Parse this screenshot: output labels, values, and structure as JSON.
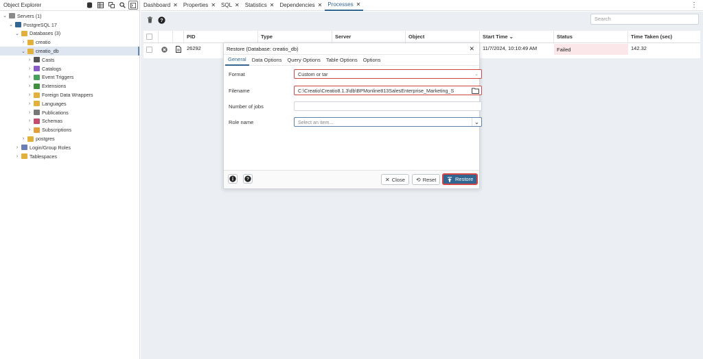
{
  "left_panel": {
    "title": "Object Explorer",
    "tree": [
      {
        "label": "Servers (1)",
        "chevron": "⌄",
        "icon": "server-group-icon",
        "color": "#8a8a8a",
        "depth": 0
      },
      {
        "label": "PostgreSQL 17",
        "chevron": "⌄",
        "icon": "postgres-elephant-icon",
        "color": "#336791",
        "depth": 1
      },
      {
        "label": "Databases (3)",
        "chevron": "⌄",
        "icon": "databases-icon",
        "color": "#e2b13c",
        "depth": 2
      },
      {
        "label": "creatio",
        "chevron": "›",
        "icon": "database-icon",
        "color": "#e2b13c",
        "depth": 3
      },
      {
        "label": "creatio_db",
        "chevron": "⌄",
        "icon": "database-icon",
        "color": "#e2b13c",
        "depth": 3,
        "selected": true
      },
      {
        "label": "Casts",
        "chevron": "›",
        "icon": "casts-icon",
        "color": "#555555",
        "depth": 4
      },
      {
        "label": "Catalogs",
        "chevron": "›",
        "icon": "catalogs-icon",
        "color": "#8a5cc7",
        "depth": 4
      },
      {
        "label": "Event Triggers",
        "chevron": "›",
        "icon": "event-triggers-icon",
        "color": "#4aa05a",
        "depth": 4
      },
      {
        "label": "Extensions",
        "chevron": "›",
        "icon": "extensions-icon",
        "color": "#3f8f3f",
        "depth": 4
      },
      {
        "label": "Foreign Data Wrappers",
        "chevron": "›",
        "icon": "foreign-data-wrappers-icon",
        "color": "#e2b13c",
        "depth": 4
      },
      {
        "label": "Languages",
        "chevron": "›",
        "icon": "languages-icon",
        "color": "#e2b13c",
        "depth": 4
      },
      {
        "label": "Publications",
        "chevron": "›",
        "icon": "publications-icon",
        "color": "#777777",
        "depth": 4
      },
      {
        "label": "Schemas",
        "chevron": "›",
        "icon": "schemas-icon",
        "color": "#c44c6c",
        "depth": 4
      },
      {
        "label": "Subscriptions",
        "chevron": "›",
        "icon": "subscriptions-icon",
        "color": "#e2a03c",
        "depth": 4
      },
      {
        "label": "postgres",
        "chevron": "›",
        "icon": "database-icon",
        "color": "#e2b13c",
        "depth": 3
      },
      {
        "label": "Login/Group Roles",
        "chevron": "›",
        "icon": "login-group-roles-icon",
        "color": "#6a7fb5",
        "depth": 2
      },
      {
        "label": "Tablespaces",
        "chevron": "›",
        "icon": "tablespaces-icon",
        "color": "#e2b13c",
        "depth": 2
      }
    ]
  },
  "tabs": [
    {
      "label": "Dashboard",
      "active": false
    },
    {
      "label": "Properties",
      "active": false
    },
    {
      "label": "SQL",
      "active": false
    },
    {
      "label": "Statistics",
      "active": false
    },
    {
      "label": "Dependencies",
      "active": false
    },
    {
      "label": "Processes",
      "active": true
    }
  ],
  "toolbar": {
    "search_placeholder": "Search"
  },
  "grid": {
    "columns": [
      "PID",
      "Type",
      "Server",
      "Object",
      "Start Time",
      "Status",
      "Time Taken (sec)"
    ],
    "sort_indicator": "⌄",
    "rows": [
      {
        "pid": "26292",
        "type": "",
        "server": "",
        "object": "",
        "start_time": "11/7/2024, 10:10:49 AM",
        "status": "Failed",
        "time_taken": "142.32"
      }
    ]
  },
  "dialog": {
    "title": "Restore (Database: creatio_db)",
    "tabs": [
      "General",
      "Data Options",
      "Query Options",
      "Table Options",
      "Options"
    ],
    "active_tab": "General",
    "fields": {
      "format_label": "Format",
      "format_value": "Custom or tar",
      "filename_label": "Filename",
      "filename_value": "C:\\Creatio\\Creatio8.1.3\\db\\BPMonline813SalesEnterprise_Marketing_S",
      "jobs_label": "Number of jobs",
      "jobs_value": "",
      "role_label": "Role name",
      "role_placeholder": "Select an item..."
    },
    "buttons": {
      "close": "Close",
      "reset": "Reset",
      "restore": "Restore"
    }
  },
  "colors": {
    "accent": "#326690",
    "error_border": "#d64545",
    "failed_bg": "#fbe7e9",
    "toolbar_bg": "#ebeef3"
  }
}
